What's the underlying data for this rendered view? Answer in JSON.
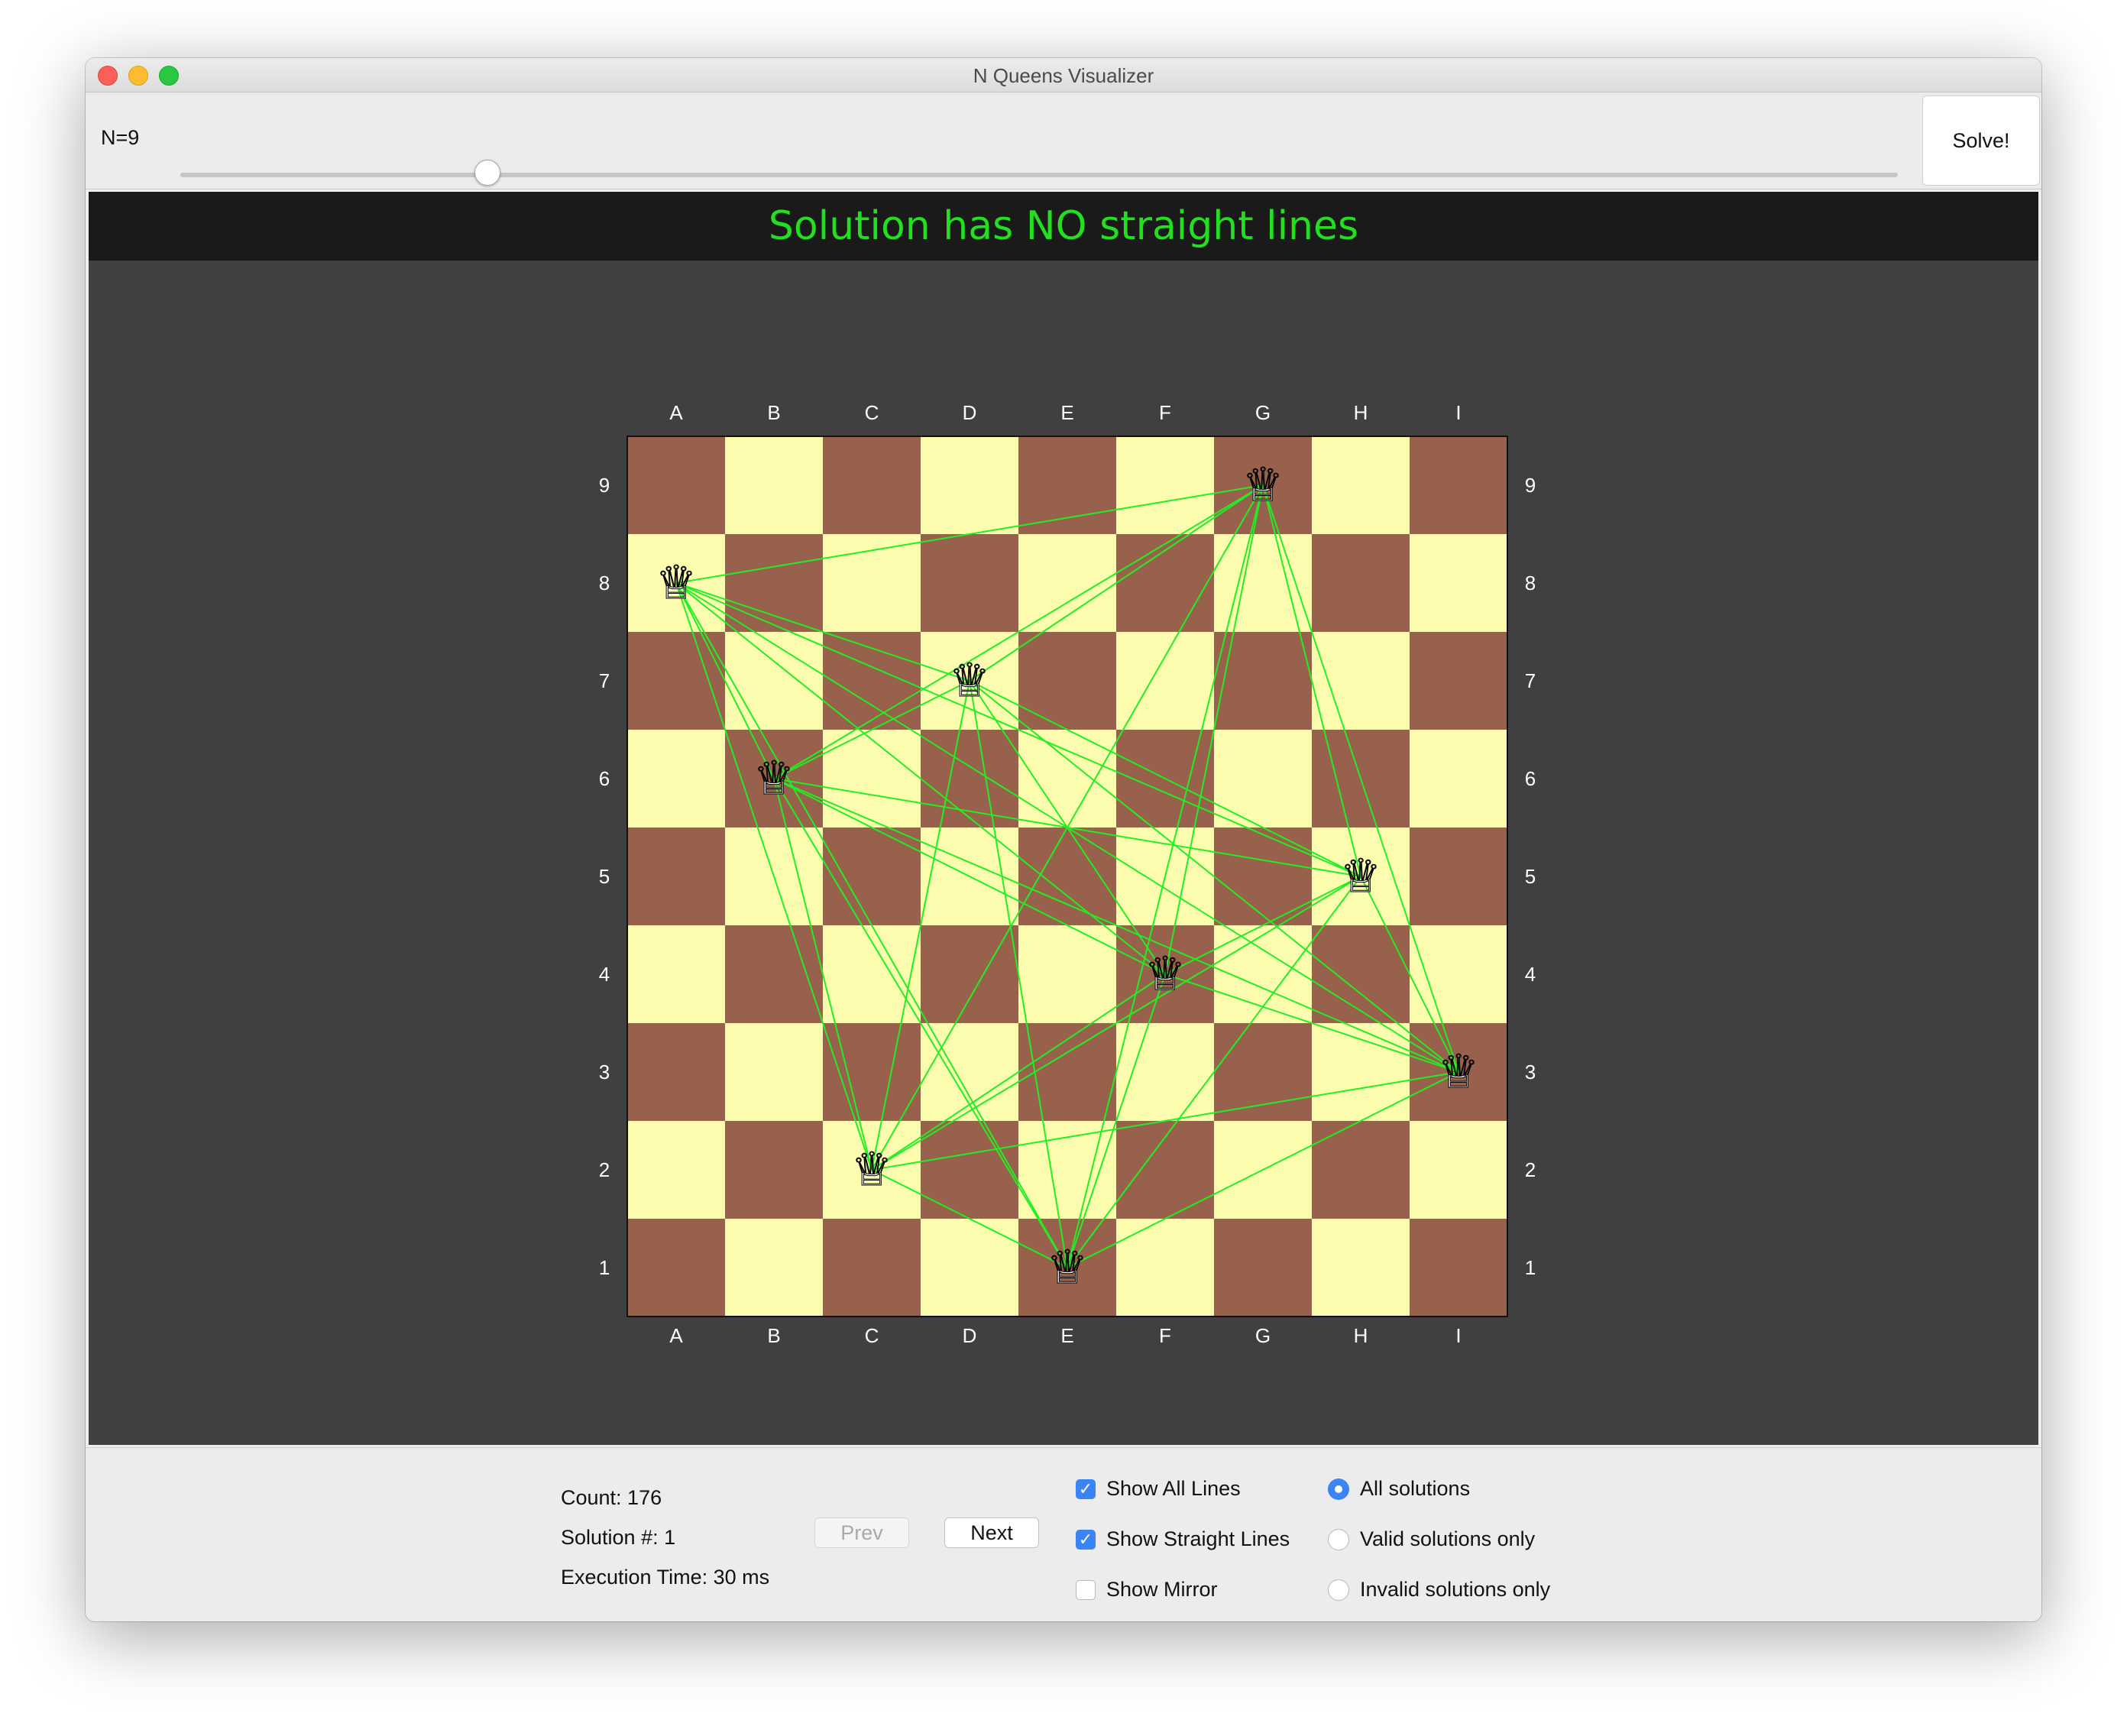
{
  "window": {
    "title": "N Queens Visualizer"
  },
  "toolbar": {
    "n_label": "N=9",
    "n_value": 9,
    "solve_label": "Solve!"
  },
  "banner": {
    "text": "Solution has NO straight lines",
    "color": "#22e01f"
  },
  "board": {
    "size": 9,
    "columns": [
      "A",
      "B",
      "C",
      "D",
      "E",
      "F",
      "G",
      "H",
      "I"
    ],
    "rows": [
      "1",
      "2",
      "3",
      "4",
      "5",
      "6",
      "7",
      "8",
      "9"
    ],
    "dark_color": "#98614b",
    "light_color": "#fdfdb0",
    "line_color": "#22ee22",
    "queen_glyph": "♕",
    "queens": [
      {
        "col": "A",
        "row": 8
      },
      {
        "col": "B",
        "row": 6
      },
      {
        "col": "C",
        "row": 2
      },
      {
        "col": "D",
        "row": 7
      },
      {
        "col": "E",
        "row": 1
      },
      {
        "col": "F",
        "row": 4
      },
      {
        "col": "G",
        "row": 9
      },
      {
        "col": "H",
        "row": 5
      },
      {
        "col": "I",
        "row": 3
      }
    ]
  },
  "stats": {
    "count": "Count: 176",
    "solution_number": "Solution #: 1",
    "execution_time": "Execution Time: 30 ms"
  },
  "nav": {
    "prev_label": "Prev",
    "next_label": "Next"
  },
  "options": {
    "checkboxes": [
      {
        "label": "Show All Lines",
        "checked": true
      },
      {
        "label": "Show Straight Lines",
        "checked": true
      },
      {
        "label": "Show Mirror",
        "checked": false
      }
    ],
    "radios": [
      {
        "label": "All solutions",
        "selected": true
      },
      {
        "label": "Valid solutions only",
        "selected": false
      },
      {
        "label": "Invalid solutions only",
        "selected": false
      }
    ]
  }
}
